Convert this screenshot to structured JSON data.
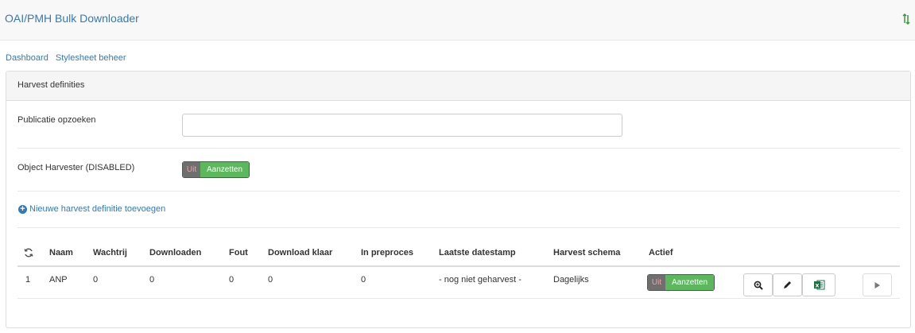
{
  "navbar": {
    "brand": "OAI/PMH Bulk Downloader",
    "icon": "sort-icon"
  },
  "breadcrumb": {
    "items": [
      "Dashboard",
      "Stylesheet beheer"
    ]
  },
  "panel": {
    "title": "Harvest definities",
    "search": {
      "label": "Publicatie opzoeken",
      "value": "",
      "placeholder": ""
    },
    "object_harvester": {
      "label": "Object Harvester (DISABLED)",
      "toggle_off": "Uit",
      "toggle_on": "Aanzetten"
    },
    "add_link": "Nieuwe harvest definitie toevoegen"
  },
  "table": {
    "headers": [
      "Naam",
      "Wachtrij",
      "Downloaden",
      "Fout",
      "Download klaar",
      "In preproces",
      "Laatste datestamp",
      "Harvest schema",
      "Actief"
    ],
    "rows": [
      {
        "id": "1",
        "naam": "ANP",
        "wachtrij": "0",
        "downloaden": "0",
        "fout": "0",
        "download_klaar": "0",
        "in_preproces": "0",
        "laatste_datestamp": "- nog niet geharvest -",
        "harvest_schema": "Dagelijks",
        "toggle_off": "Uit",
        "toggle_on": "Aanzetten"
      }
    ]
  },
  "colors": {
    "accent": "#337ab7",
    "success": "#5cb85c",
    "excel": "#1d7044"
  }
}
